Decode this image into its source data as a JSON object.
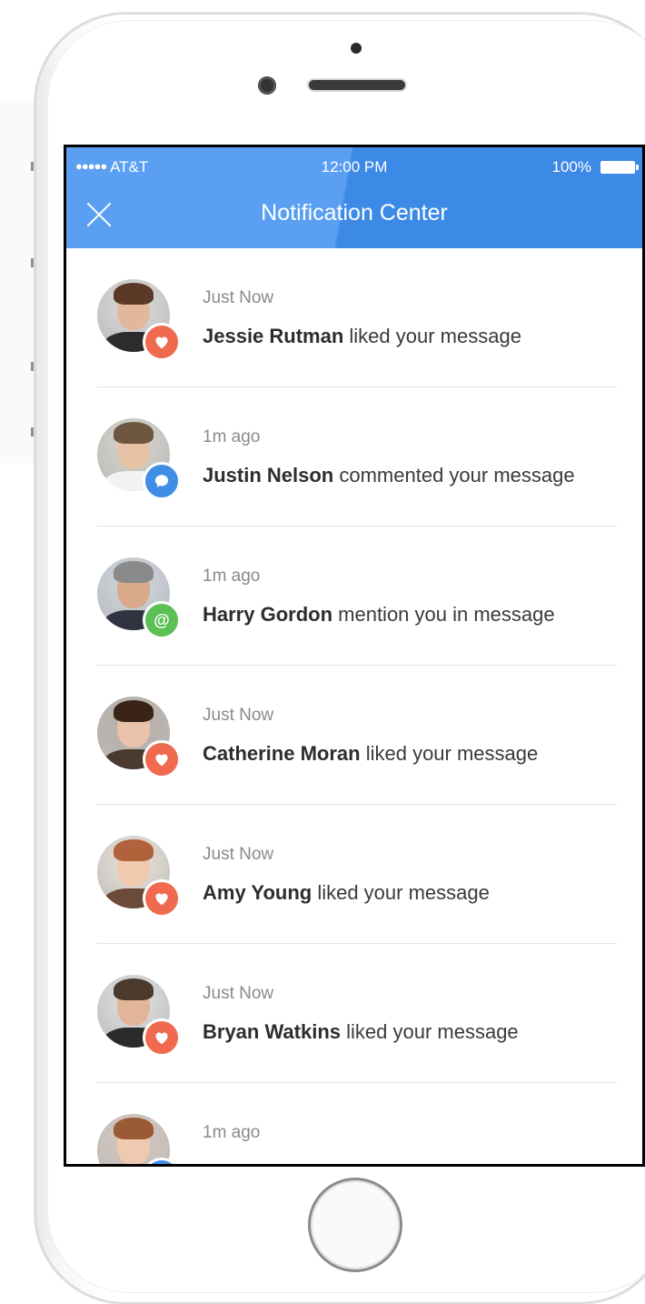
{
  "status_bar": {
    "carrier": "AT&T",
    "signal_dots": "●●●●●",
    "time": "12:00 PM",
    "battery": "100%"
  },
  "header": {
    "title": "Notification Center",
    "close_icon": "close-icon"
  },
  "colors": {
    "header_blue": "#3d8ae6",
    "like": "#f06a4f",
    "comment": "#3f8ee6",
    "mention": "#5cc055"
  },
  "notifications": [
    {
      "time": "Just Now",
      "name": "Jessie Rutman",
      "action": " liked your message",
      "type": "like",
      "icon": "heart-icon"
    },
    {
      "time": "1m ago",
      "name": "Justin Nelson",
      "action": " commented your message",
      "type": "comment",
      "icon": "comment-icon"
    },
    {
      "time": "1m ago",
      "name": "Harry Gordon",
      "action": " mention you in message",
      "type": "mention",
      "icon": "at-icon"
    },
    {
      "time": "Just Now",
      "name": "Catherine Moran",
      "action": " liked your message",
      "type": "like",
      "icon": "heart-icon"
    },
    {
      "time": "Just Now",
      "name": "Amy Young",
      "action": " liked your message",
      "type": "like",
      "icon": "heart-icon"
    },
    {
      "time": "Just Now",
      "name": "Bryan Watkins",
      "action": " liked your message",
      "type": "like",
      "icon": "heart-icon"
    },
    {
      "time": "1m ago",
      "name": "",
      "action": "",
      "type": "comment",
      "icon": "comment-icon"
    }
  ]
}
